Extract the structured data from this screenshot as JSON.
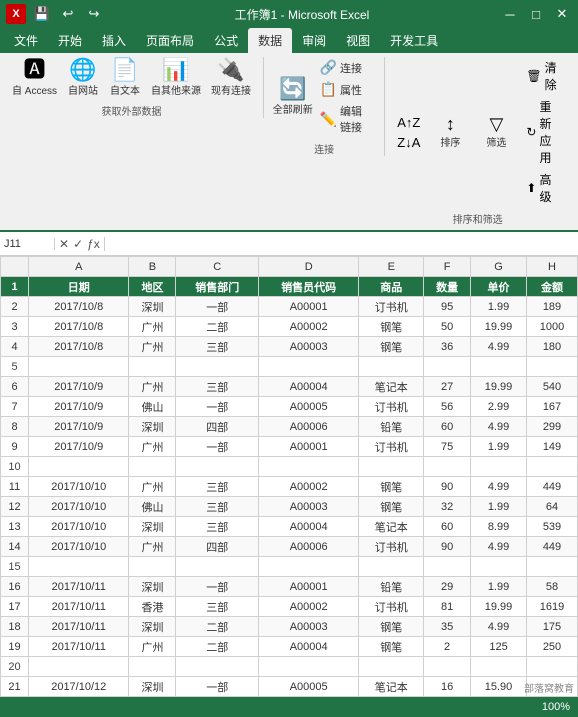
{
  "app": {
    "title": "工作簿1 - Microsoft Excel"
  },
  "ribbon": {
    "quickbtns": [
      "💾",
      "↩",
      "↪"
    ],
    "tabs": [
      "文件",
      "开始",
      "插入",
      "页面布局",
      "公式",
      "数据",
      "审阅",
      "视图",
      "开发工具"
    ],
    "active_tab": "数据",
    "groups": [
      {
        "name": "获取外部数据",
        "buttons": [
          {
            "icon": "🅰",
            "label": "自 Access"
          },
          {
            "icon": "🌐",
            "label": "自网站"
          },
          {
            "icon": "📄",
            "label": "自文本"
          },
          {
            "icon": "📊",
            "label": "自其他来源"
          },
          {
            "icon": "🔌",
            "label": "现有连接"
          }
        ]
      },
      {
        "name": "连接",
        "buttons": [
          {
            "icon": "🔄",
            "label": "全部刷新"
          },
          {
            "icon": "🔗",
            "label": "连接"
          },
          {
            "icon": "📋",
            "label": "属性"
          },
          {
            "icon": "✏️",
            "label": "编辑链接"
          }
        ]
      },
      {
        "name": "排序和筛选",
        "buttons": [
          {
            "icon": "↕",
            "label": "排序"
          },
          {
            "icon": "▼",
            "label": "筛选"
          },
          {
            "icon": "🗑",
            "label": "清除"
          },
          {
            "icon": "↻",
            "label": "重新应用"
          },
          {
            "icon": "⬆",
            "label": "高级"
          }
        ]
      }
    ]
  },
  "formula_bar": {
    "cell_ref": "J11",
    "formula": ""
  },
  "columns": [
    "A",
    "B",
    "C",
    "D",
    "E",
    "F",
    "G",
    "H"
  ],
  "headers": [
    "日期",
    "地区",
    "销售部门",
    "销售员代码",
    "商品",
    "数量",
    "单价",
    "金额"
  ],
  "rows": [
    {
      "num": 1,
      "type": "header",
      "cells": [
        "日期",
        "地区",
        "销售部门",
        "销售员代码",
        "商品",
        "数量",
        "单价",
        "金额"
      ]
    },
    {
      "num": 2,
      "type": "data",
      "cells": [
        "2017/10/8",
        "深圳",
        "一部",
        "A00001",
        "订书机",
        "95",
        "1.99",
        "189"
      ]
    },
    {
      "num": 3,
      "type": "data",
      "cells": [
        "2017/10/8",
        "广州",
        "二部",
        "A00002",
        "钢笔",
        "50",
        "19.99",
        "1000"
      ]
    },
    {
      "num": 4,
      "type": "data",
      "cells": [
        "2017/10/8",
        "广州",
        "三部",
        "A00003",
        "钢笔",
        "36",
        "4.99",
        "180"
      ]
    },
    {
      "num": 5,
      "type": "empty",
      "cells": [
        "",
        "",
        "",
        "",
        "",
        "",
        "",
        ""
      ]
    },
    {
      "num": 6,
      "type": "data",
      "cells": [
        "2017/10/9",
        "广州",
        "三部",
        "A00004",
        "笔记本",
        "27",
        "19.99",
        "540"
      ]
    },
    {
      "num": 7,
      "type": "data",
      "cells": [
        "2017/10/9",
        "佛山",
        "一部",
        "A00005",
        "订书机",
        "56",
        "2.99",
        "167"
      ]
    },
    {
      "num": 8,
      "type": "data",
      "cells": [
        "2017/10/9",
        "深圳",
        "四部",
        "A00006",
        "铅笔",
        "60",
        "4.99",
        "299"
      ]
    },
    {
      "num": 9,
      "type": "data",
      "cells": [
        "2017/10/9",
        "广州",
        "一部",
        "A00001",
        "订书机",
        "75",
        "1.99",
        "149"
      ]
    },
    {
      "num": 10,
      "type": "empty",
      "cells": [
        "",
        "",
        "",
        "",
        "",
        "",
        "",
        ""
      ]
    },
    {
      "num": 11,
      "type": "data",
      "cells": [
        "2017/10/10",
        "广州",
        "三部",
        "A00002",
        "钢笔",
        "90",
        "4.99",
        "449"
      ]
    },
    {
      "num": 12,
      "type": "data",
      "cells": [
        "2017/10/10",
        "佛山",
        "三部",
        "A00003",
        "钢笔",
        "32",
        "1.99",
        "64"
      ]
    },
    {
      "num": 13,
      "type": "data",
      "cells": [
        "2017/10/10",
        "深圳",
        "三部",
        "A00004",
        "笔记本",
        "60",
        "8.99",
        "539"
      ]
    },
    {
      "num": 14,
      "type": "data",
      "cells": [
        "2017/10/10",
        "广州",
        "四部",
        "A00006",
        "订书机",
        "90",
        "4.99",
        "449"
      ]
    },
    {
      "num": 15,
      "type": "empty",
      "cells": [
        "",
        "",
        "",
        "",
        "",
        "",
        "",
        ""
      ]
    },
    {
      "num": 16,
      "type": "data",
      "cells": [
        "2017/10/11",
        "深圳",
        "一部",
        "A00001",
        "铅笔",
        "29",
        "1.99",
        "58"
      ]
    },
    {
      "num": 17,
      "type": "data",
      "cells": [
        "2017/10/11",
        "香港",
        "三部",
        "A00002",
        "订书机",
        "81",
        "19.99",
        "1619"
      ]
    },
    {
      "num": 18,
      "type": "data",
      "cells": [
        "2017/10/11",
        "深圳",
        "二部",
        "A00003",
        "钢笔",
        "35",
        "4.99",
        "175"
      ]
    },
    {
      "num": 19,
      "type": "data",
      "cells": [
        "2017/10/11",
        "广州",
        "二部",
        "A00004",
        "钢笔",
        "2",
        "125",
        "250"
      ]
    },
    {
      "num": 20,
      "type": "empty",
      "cells": [
        "",
        "",
        "",
        "",
        "",
        "",
        "",
        ""
      ]
    },
    {
      "num": 21,
      "type": "data",
      "cells": [
        "2017/10/12",
        "深圳",
        "一部",
        "A00005",
        "笔记本",
        "16",
        "15.90",
        ""
      ]
    }
  ],
  "watermark": "部落窝教育",
  "status": {
    "left": "",
    "right": "100%"
  }
}
